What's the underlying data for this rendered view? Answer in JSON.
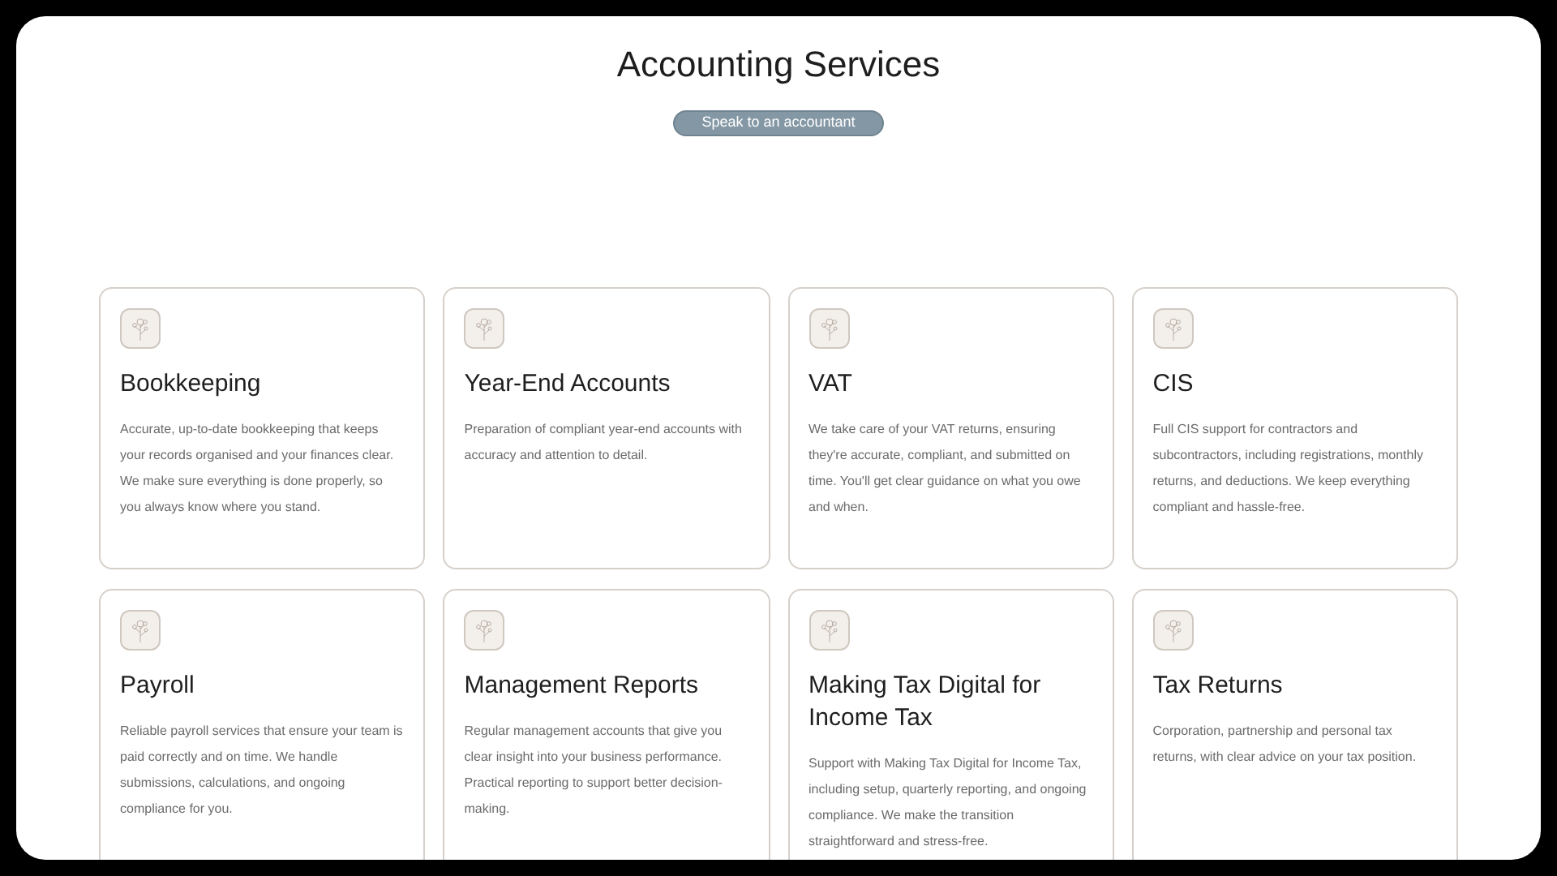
{
  "page": {
    "title": "Accounting Services",
    "cta_button": "Speak to an accountant"
  },
  "services": [
    {
      "title": "Bookkeeping",
      "description": "Accurate, up-to-date bookkeeping that keeps your records organised and your finances clear. We make sure everything is done properly, so you always know where you stand."
    },
    {
      "title": "Year-End Accounts",
      "description": "Preparation of compliant year-end accounts with accuracy and attention to detail."
    },
    {
      "title": "VAT",
      "description": "We take care of your VAT returns, ensuring they're accurate, compliant, and submitted on time. You'll get clear guidance on what you owe and when."
    },
    {
      "title": "CIS",
      "description": "Full CIS support for contractors and subcontractors, including registrations, monthly returns, and deductions. We keep everything compliant and hassle-free."
    },
    {
      "title": "Payroll",
      "description": "Reliable payroll services that ensure your team is paid correctly and on time. We handle submissions, calculations, and ongoing compliance for you."
    },
    {
      "title": "Management Reports",
      "description": "Regular management accounts that give you clear insight into your business performance. Practical reporting to support better decision-making."
    },
    {
      "title": "Making Tax Digital for Income Tax",
      "description": "Support with Making Tax Digital for Income Tax, including setup, quarterly reporting, and ongoing compliance. We make the transition straightforward and stress-free."
    },
    {
      "title": "Tax Returns",
      "description": "Corporation, partnership and personal tax returns, with clear advice on your tax position."
    }
  ]
}
